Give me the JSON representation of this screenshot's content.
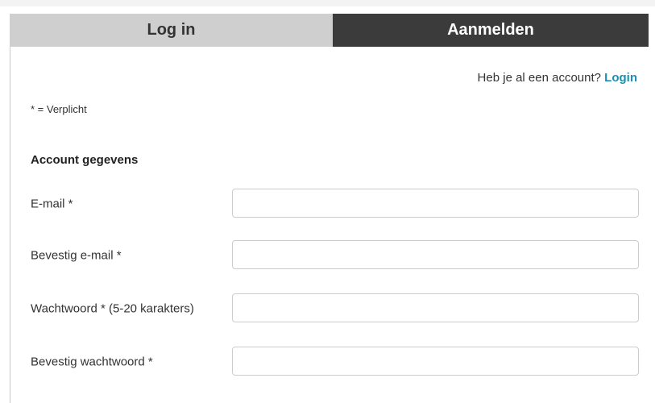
{
  "tabs": {
    "login_label": "Log in",
    "register_label": "Aanmelden",
    "active": "Aanmelden"
  },
  "account": {
    "question": "Heb je al een account?",
    "login_link": "Login"
  },
  "form": {
    "required_note": "* = Verplicht",
    "section_title": "Account gegevens",
    "fields": [
      {
        "label": "E-mail *",
        "value": "",
        "placeholder": ""
      },
      {
        "label": "Bevestig e-mail *",
        "value": "",
        "placeholder": ""
      },
      {
        "label": "Wachtwoord * (5-20 karakters)",
        "value": "",
        "placeholder": ""
      },
      {
        "label": "Bevestig wachtwoord *",
        "value": "",
        "placeholder": ""
      }
    ]
  },
  "colors": {
    "link": "#1a8fb1",
    "active_tab_bg": "#3b3b3b",
    "inactive_tab_bg": "#cfcfcf"
  }
}
